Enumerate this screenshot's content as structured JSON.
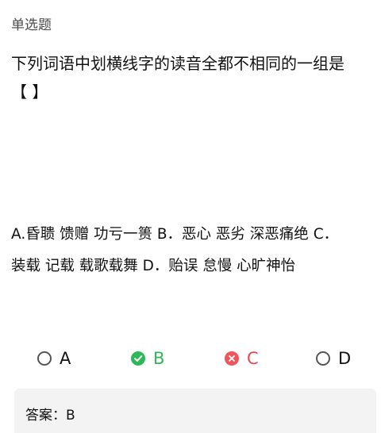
{
  "question_type": "单选题",
  "question_text": "下列词语中划横线字的读音全都不相同的一组是\n【 】",
  "choices_text": "A.昏聩 馈赠 功亏一篑 B．恶心 恶劣 深恶痛绝 C．\n装载 记载 载歌载舞 D．贻误 怠慢 心旷神怡",
  "options": [
    {
      "label": "A",
      "state": "unselected"
    },
    {
      "label": "B",
      "state": "correct"
    },
    {
      "label": "C",
      "state": "wrong"
    },
    {
      "label": "D",
      "state": "unselected"
    }
  ],
  "answer": "答案：B",
  "colors": {
    "correct": "#2fb85a",
    "wrong": "#f0555a",
    "answer_bg": "#f3f3f3"
  },
  "icons": {
    "correct": "check-icon",
    "wrong": "cross-icon"
  }
}
